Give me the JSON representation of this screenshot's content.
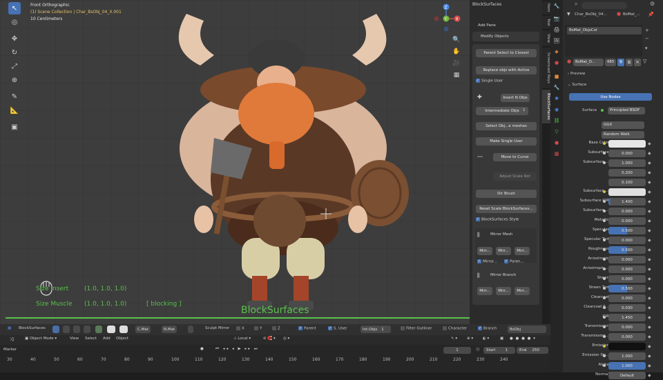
{
  "viewport": {
    "view_name": "Front Orthographic",
    "collection": "(1) Scene Collection | Char_BsObj_04_X.001",
    "scale": "10 Centimeters",
    "overlay_size_insert": "Size Insert",
    "overlay_size_insert_val": "(1.0, 1.0, 1.0)",
    "overlay_size_muscle": "Size Muscle",
    "overlay_size_muscle_val": "(1.0, 1.0, 1.0)",
    "overlay_blocking": "[ blocking ]",
    "overlay_title": "BlockSurfaces",
    "gizmo_x": "X",
    "gizmo_y": "Y",
    "gizmo_z": "Z",
    "accent_green": "#59c24a"
  },
  "npanel": {
    "title": "BlockSurfaces",
    "add_pane": "Add Pane",
    "modify_objects": "Modify Objects",
    "parent_select_to_closest": "Parent Select to Closest",
    "replace_objs_with_active": "Replace objs with Active",
    "single_user": "Single User",
    "insert_n_objs": "Insert N Objs",
    "intermediate_objs": "Intermediate Objs",
    "intermediate_objs_val": "1",
    "select_obj_meshes": "Select Obj...e meshes",
    "make_single_user": "Make Single User",
    "move_to_curve": "Move to Curve",
    "adjust_scale_rot": "Adjust Scale Rot",
    "dir_brush": "Dir Brush",
    "reset_scale": "Reset Scale BlockSurfaces...",
    "blocksurfaces_style": "BlockSurfaces Style",
    "mirror_mesh": "Mirror Mesh",
    "mir1": "Mirr...",
    "mir2": "Mirr...",
    "mir3": "Mirr...",
    "mirror_check1": "Mirror...",
    "mirror_check2": "Paren...",
    "mirror_branch": "Mirror Branch",
    "mir4": "Mirr...",
    "mir5": "Mirr...",
    "mir6": "Mirr..."
  },
  "vtabs": [
    "Item",
    "Tool",
    "View",
    "Screencast Keys",
    "BlockSurfaces"
  ],
  "properties": {
    "search_placeholder": "",
    "object_name": "Char_BsObj_04...",
    "material_name": "BsMat_...",
    "slot_item": "BsMat_ObjsCol",
    "mat_field": "BsMat_O...",
    "users": "485",
    "preview": "Preview",
    "surface_section": "Surface",
    "use_nodes": "Use Nodes",
    "surface_label": "Surface",
    "surface_value": "Principled BSDF",
    "distribution": "GGX",
    "subsurface_method": "Random Walk",
    "rows": [
      {
        "label": "Base Color",
        "value": "",
        "kind": "color",
        "color": "#e6e6e6",
        "dot": "y"
      },
      {
        "label": "Subsurface",
        "value": "0.000",
        "kind": "num",
        "dot": "g"
      },
      {
        "label": "Subsurface ...",
        "value": "1.000",
        "kind": "num",
        "dot": "g"
      },
      {
        "label": "",
        "value": "0.200",
        "kind": "num",
        "dot": ""
      },
      {
        "label": "",
        "value": "0.100",
        "kind": "num",
        "dot": ""
      },
      {
        "label": "Subsurface ...",
        "value": "",
        "kind": "color",
        "color": "#e0e0e0",
        "dot": "y"
      },
      {
        "label": "Subsurface IOR",
        "value": "1.400",
        "kind": "bar",
        "fill": 0.05,
        "dot": "g"
      },
      {
        "label": "Subsurface ...",
        "value": "0.000",
        "kind": "num",
        "dot": "g"
      },
      {
        "label": "Metallic",
        "value": "0.000",
        "kind": "num",
        "dot": "g"
      },
      {
        "label": "Specular",
        "value": "0.500",
        "kind": "bar",
        "fill": 0.5,
        "dot": "g"
      },
      {
        "label": "Specular Tint",
        "value": "0.000",
        "kind": "num",
        "dot": "g"
      },
      {
        "label": "Roughness",
        "value": "0.500",
        "kind": "bar",
        "fill": 0.5,
        "dot": "g"
      },
      {
        "label": "Anisotropic",
        "value": "0.000",
        "kind": "num",
        "dot": "g"
      },
      {
        "label": "Anisotropic ...",
        "value": "0.000",
        "kind": "num",
        "dot": "g"
      },
      {
        "label": "Sheen",
        "value": "0.000",
        "kind": "num",
        "dot": "g"
      },
      {
        "label": "Sheen Tint",
        "value": "0.500",
        "kind": "bar",
        "fill": 0.5,
        "dot": "g"
      },
      {
        "label": "Clearcoat",
        "value": "0.000",
        "kind": "num",
        "dot": "g"
      },
      {
        "label": "Clearcoat R...",
        "value": "0.030",
        "kind": "num",
        "dot": "g"
      },
      {
        "label": "IOR",
        "value": "1.450",
        "kind": "num",
        "dot": "g"
      },
      {
        "label": "Transmission",
        "value": "0.000",
        "kind": "num",
        "dot": "g"
      },
      {
        "label": "Transmission...",
        "value": "0.000",
        "kind": "num",
        "dot": "g"
      },
      {
        "label": "Emission",
        "value": "",
        "kind": "color",
        "color": "#111111",
        "dot": "y"
      },
      {
        "label": "Emission Str...",
        "value": "1.000",
        "kind": "num",
        "dot": "g"
      },
      {
        "label": "Alpha",
        "value": "1.000",
        "kind": "bar",
        "fill": 1.0,
        "dot": "g"
      },
      {
        "label": "Normal",
        "value": "Default",
        "kind": "num",
        "dot": ""
      }
    ]
  },
  "bottombar": {
    "name": "BlockSurfaces",
    "cmat": "C.Mat",
    "nmat": "N.Mat",
    "sculpt_mirror": "Sculpt Mirror",
    "axis_x": "X",
    "axis_y": "Y",
    "axis_z": "Z",
    "parent": "Parent",
    "s_user": "S. User",
    "int_objs": "Int.Objs",
    "int_objs_val": "1",
    "filter_outliner": "Filter Outliner",
    "character": "Character",
    "branch": "Branch",
    "bsobj": "BsObj"
  },
  "header": {
    "mode": "Object Mode",
    "view": "View",
    "select": "Select",
    "add": "Add",
    "object": "Object",
    "transform": "Local"
  },
  "timeline": {
    "marker": "Marker",
    "current_frame": "1",
    "start_label": "Start",
    "start": "1",
    "end_label": "End",
    "end": "250",
    "ticks": [
      "30",
      "40",
      "50",
      "60",
      "70",
      "80",
      "90",
      "100",
      "110",
      "120",
      "130",
      "140",
      "150",
      "160",
      "170",
      "180",
      "190",
      "200",
      "210",
      "220",
      "230",
      "240"
    ]
  }
}
